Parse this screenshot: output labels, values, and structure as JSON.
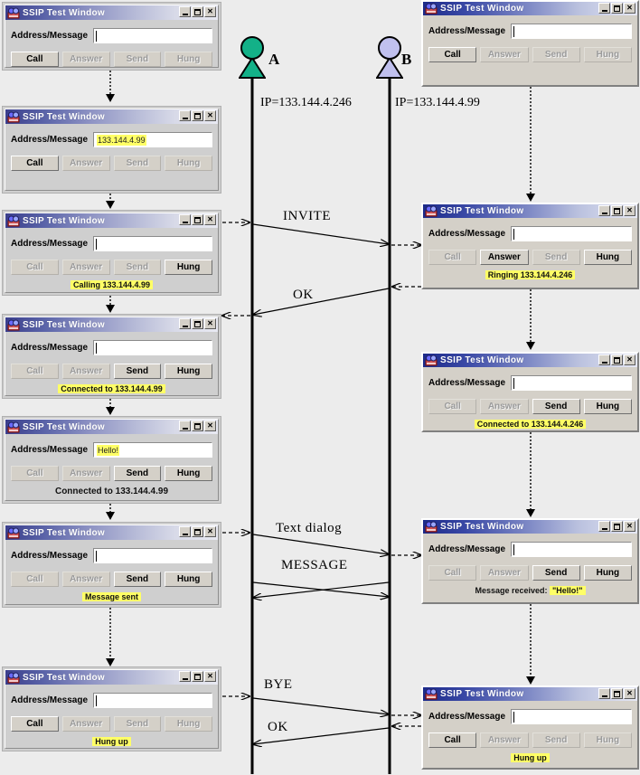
{
  "window": {
    "title": "SSIP Test Window",
    "address_label": "Address/Message",
    "buttons": {
      "call": "Call",
      "answer": "Answer",
      "send": "Send",
      "hung": "Hung"
    },
    "titlebar": {
      "minimize": "_",
      "maximize": "□",
      "close": "✕"
    }
  },
  "diagram": {
    "actor_a": {
      "label": "A",
      "ip": "IP=133.144.4.246",
      "color": "#13b188"
    },
    "actor_b": {
      "label": "B",
      "ip": "IP=133.144.4.99",
      "color": "#c0c0ee"
    },
    "messages": [
      {
        "name": "INVITE",
        "label": "INVITE"
      },
      {
        "name": "OK",
        "label": "OK"
      },
      {
        "name": "Text dialog",
        "label": "Text dialog"
      },
      {
        "name": "MESSAGE",
        "label": "MESSAGE"
      },
      {
        "name": "BYE",
        "label": "BYE"
      },
      {
        "name": "OK2",
        "label": "OK"
      }
    ]
  },
  "left_windows": [
    {
      "field_value": "",
      "field_highlight": false,
      "status": "",
      "status_highlight": false,
      "enabled": {
        "call": true,
        "answer": false,
        "send": false,
        "hung": false
      }
    },
    {
      "field_value": "133.144.4.99",
      "field_highlight": true,
      "status": "",
      "status_highlight": false,
      "enabled": {
        "call": true,
        "answer": false,
        "send": false,
        "hung": false
      }
    },
    {
      "field_value": "",
      "field_highlight": false,
      "status": "Calling 133.144.4.99",
      "status_highlight": true,
      "enabled": {
        "call": false,
        "answer": false,
        "send": false,
        "hung": true
      }
    },
    {
      "field_value": "",
      "field_highlight": false,
      "status": "Connected to 133.144.4.99",
      "status_highlight": true,
      "enabled": {
        "call": false,
        "answer": false,
        "send": true,
        "hung": true
      }
    },
    {
      "field_value": "Hello!",
      "field_highlight": true,
      "status": "Connected to 133.144.4.99",
      "status_highlight": false,
      "enabled": {
        "call": false,
        "answer": false,
        "send": true,
        "hung": true
      }
    },
    {
      "field_value": "",
      "field_highlight": false,
      "status": "Message sent",
      "status_highlight": true,
      "enabled": {
        "call": false,
        "answer": false,
        "send": true,
        "hung": true
      }
    },
    {
      "field_value": "",
      "field_highlight": false,
      "status": "Hung up",
      "status_highlight": true,
      "enabled": {
        "call": true,
        "answer": false,
        "send": false,
        "hung": false
      }
    }
  ],
  "right_windows": [
    {
      "field_value": "",
      "field_highlight": false,
      "status": "",
      "status_highlight": false,
      "enabled": {
        "call": true,
        "answer": false,
        "send": false,
        "hung": false
      }
    },
    {
      "field_value": "",
      "field_highlight": false,
      "status": "Ringing 133.144.4.246",
      "status_highlight": true,
      "enabled": {
        "call": false,
        "answer": true,
        "send": false,
        "hung": true
      }
    },
    {
      "field_value": "",
      "field_highlight": false,
      "status": "Connected to 133.144.4.246",
      "status_highlight": true,
      "enabled": {
        "call": false,
        "answer": false,
        "send": true,
        "hung": true
      }
    },
    {
      "field_value": "",
      "field_highlight": false,
      "status": "Message received: \"Hello!\"",
      "status_highlight": "partial",
      "status_plain": "Message received:",
      "status_hl": "\"Hello!\"",
      "enabled": {
        "call": false,
        "answer": false,
        "send": true,
        "hung": true
      }
    },
    {
      "field_value": "",
      "field_highlight": false,
      "status": "Hung up",
      "status_highlight": true,
      "enabled": {
        "call": true,
        "answer": false,
        "send": false,
        "hung": false
      }
    }
  ]
}
